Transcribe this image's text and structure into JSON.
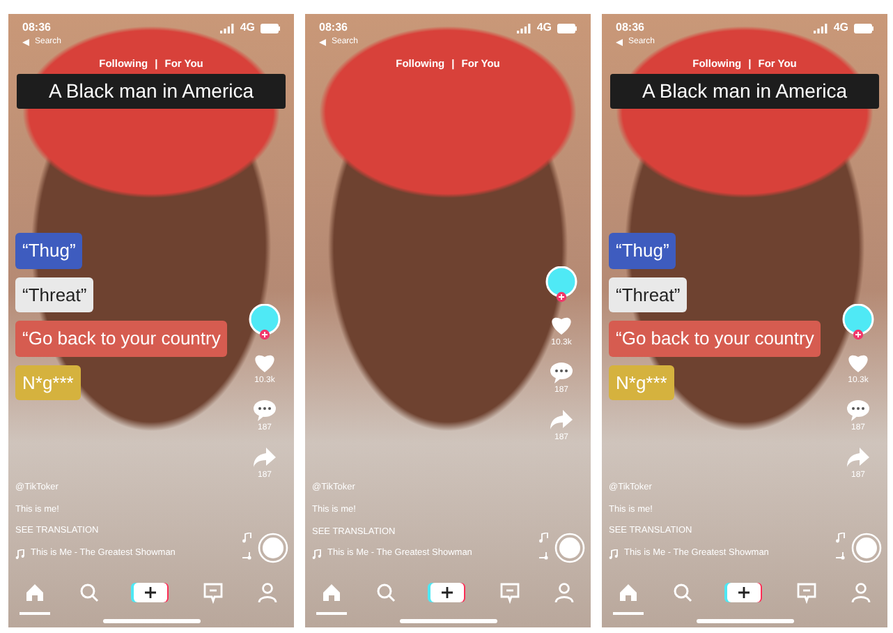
{
  "phones": [
    {
      "status": {
        "time": "08:36",
        "back": "Search",
        "network": "4G"
      },
      "tabs": [
        "Following",
        "|",
        "For You"
      ],
      "caption": "A Black man in America",
      "labels": [
        {
          "text": "“Thug”",
          "color": "#3e5cbf"
        },
        {
          "text": "“Threat”",
          "color": "#e9e9e9"
        },
        {
          "text": "“Go back to your country",
          "color": "#d65c50"
        },
        {
          "text": "N*g***",
          "color": "#d5b23e"
        }
      ],
      "actions": {
        "likes": "10.3k",
        "comments": "187",
        "shares": "187"
      },
      "username": "@TikToker",
      "description": "This is me!",
      "translate": "SEE TRANSLATION",
      "music": "This is Me - The Greatest Showman",
      "nav": [
        {
          "kind": "home",
          "selected": true
        },
        {
          "kind": "search",
          "selected": false
        },
        {
          "kind": "create",
          "selected": false
        },
        {
          "kind": "inbox",
          "selected": false
        },
        {
          "kind": "profile",
          "selected": false
        }
      ]
    },
    {
      "status": {
        "time": "08:36",
        "back": "Search",
        "network": "4G"
      },
      "tabs": [
        "Following",
        "|",
        "For You"
      ],
      "actions": {
        "likes": "10.3k",
        "comments": "187",
        "shares": "187"
      },
      "username": "@TikToker",
      "description": "This is me!",
      "translate": "SEE TRANSLATION",
      "music": "This is Me - The Greatest Showman",
      "nav": [
        {
          "kind": "home",
          "selected": true
        },
        {
          "kind": "search",
          "selected": false
        },
        {
          "kind": "create",
          "selected": false
        },
        {
          "kind": "inbox",
          "selected": false
        },
        {
          "kind": "profile",
          "selected": false
        }
      ]
    },
    {
      "status": {
        "time": "08:36",
        "back": "Search",
        "network": "4G"
      },
      "tabs": [
        "Following",
        "|",
        "For You"
      ],
      "caption": "A Black man in America",
      "labels": [
        {
          "text": "“Thug”",
          "color": "#3e5cbf"
        },
        {
          "text": "“Threat”",
          "color": "#e9e9e9"
        },
        {
          "text": "“Go back to your country",
          "color": "#d65c50"
        },
        {
          "text": "N*g***",
          "color": "#d5b23e"
        }
      ],
      "actions": {
        "likes": "10.3k",
        "comments": "187",
        "shares": "187"
      },
      "username": "@TikToker",
      "description": "This is me!",
      "translate": "SEE TRANSLATION",
      "music": "This is Me - The Greatest Showman",
      "nav": [
        {
          "kind": "home",
          "selected": true
        },
        {
          "kind": "search",
          "selected": false
        },
        {
          "kind": "create",
          "selected": false
        },
        {
          "kind": "inbox",
          "selected": false
        },
        {
          "kind": "profile",
          "selected": false
        }
      ]
    }
  ]
}
